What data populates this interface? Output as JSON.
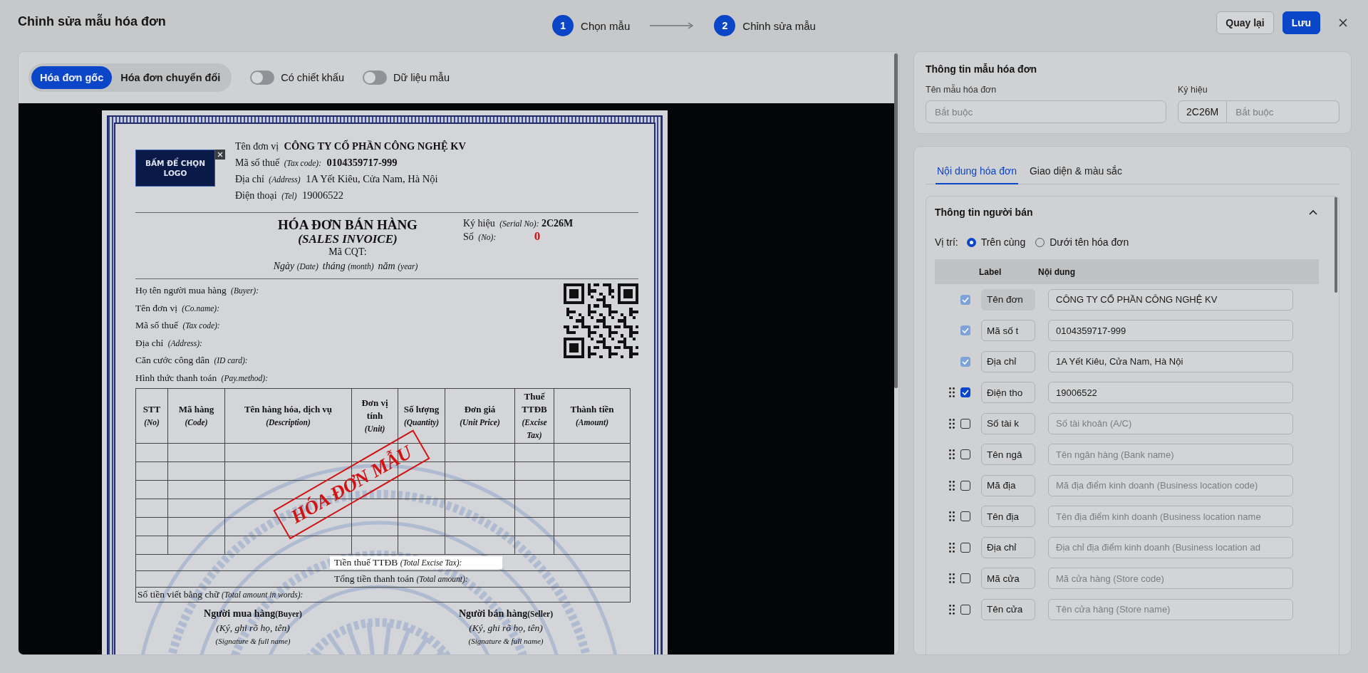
{
  "header": {
    "title": "Chỉnh sửa mẫu hóa đơn",
    "steps": [
      {
        "number": "1",
        "label": "Chọn mẫu"
      },
      {
        "number": "2",
        "label": "Chỉnh sửa mẫu"
      }
    ],
    "buttons": [
      {
        "label": "Quay lại",
        "kind": "secondary"
      },
      {
        "label": "Lưu",
        "kind": "primary"
      }
    ]
  },
  "toolbar": {
    "segments": [
      {
        "label": "Hóa đơn gốc",
        "selected": true
      },
      {
        "label": "Hóa đơn chuyển đổi",
        "selected": false
      }
    ],
    "toggles": [
      {
        "label": "Có chiết khấu",
        "on": false
      },
      {
        "label": "Dữ liệu mẫu",
        "on": false
      }
    ]
  },
  "invoice": {
    "logo_button": "BẤM ĐỂ CHỌN LOGO",
    "seller": [
      {
        "label": "Tên đơn vị",
        "value": "CÔNG TY CỔ PHẦN CÔNG NGHỆ KV",
        "bold": true
      },
      {
        "label": "Mã số thuế",
        "label_en": "(Tax code):",
        "value": "0104359717-999",
        "bold": true
      },
      {
        "label": "Địa chỉ",
        "label_en": "(Address)",
        "value": "1A Yết Kiêu, Cửa Nam, Hà Nội",
        "bold": false
      },
      {
        "label": "Điện thoại",
        "label_en": "(Tel)",
        "value": "19006522",
        "bold": false
      }
    ],
    "title": "HÓA ĐƠN BÁN HÀNG",
    "subtitle": "(SALES INVOICE)",
    "cqt": "Mã CQT:",
    "date_parts": [
      {
        "label": "Ngày",
        "en": "(Date)"
      },
      {
        "label": "tháng",
        "en": "(month)"
      },
      {
        "label": "năm",
        "en": "(year)"
      }
    ],
    "serial": {
      "label": "Ký hiệu",
      "label_en": "(Serial No):",
      "value": "2C26M"
    },
    "number": {
      "label": "Số",
      "label_en": "(No):",
      "value": "0"
    },
    "buyer": [
      {
        "label": "Họ tên người mua hàng",
        "label_en": "(Buyer):"
      },
      {
        "label": "Tên đơn vị",
        "label_en": "(Co.name):"
      },
      {
        "label": "Mã số thuế",
        "label_en": "(Tax code):"
      },
      {
        "label": "Địa chỉ",
        "label_en": "(Address):"
      },
      {
        "label": "Căn cước công dân",
        "label_en": "(ID card):"
      },
      {
        "label": "Hình thức thanh toán",
        "label_en": "(Pay.method):"
      }
    ],
    "columns": [
      {
        "label": "STT",
        "label_en": "(No)"
      },
      {
        "label": "Mã hàng",
        "label_en": "(Code)"
      },
      {
        "label": "Tên hàng hóa, dịch vụ",
        "label_en": "(Description)"
      },
      {
        "label": "Đơn vị tính",
        "label_en": "(Unit)"
      },
      {
        "label": "Số lượng",
        "label_en": "(Quantity)"
      },
      {
        "label": "Đơn giá",
        "label_en": "(Unit Price)"
      },
      {
        "label": "Thuế TTĐB",
        "label_en": "(Excise Tax)"
      },
      {
        "label": "Thành tiền",
        "label_en": "(Amount)"
      }
    ],
    "totals": [
      {
        "label": "Tiền thuế TTĐB",
        "label_en": "(Total Excise Tax):",
        "highlighted": true
      },
      {
        "label": "Tổng tiền thanh toán",
        "label_en": "(Total amount):",
        "highlighted": false
      }
    ],
    "in_words": {
      "label": "Số tiền viết bằng chữ",
      "label_en": "(Total amount in words):"
    },
    "signatures": [
      {
        "title": "Người mua hàng",
        "title_en": "(Buyer)",
        "note": "(Ký, ghi rõ họ, tên)",
        "note_en": "(Signature & full name)"
      },
      {
        "title": "Người bán hàng",
        "title_en": "(Seller)",
        "note": "(Ký, ghi rõ họ, tên)",
        "note_en": "(Signature & full name)"
      }
    ],
    "stamp": "HÓA ĐƠN MẪU"
  },
  "template_info": {
    "title": "Thông tin mẫu hóa đơn",
    "name_field": {
      "label": "Tên mẫu hóa đơn",
      "placeholder": "Bắt buộc"
    },
    "symbol_field": {
      "label": "Ký hiệu",
      "prefix": "2C26M",
      "placeholder": "Bắt buộc"
    }
  },
  "content_tabs": [
    {
      "label": "Nội dung hóa đơn",
      "selected": true
    },
    {
      "label": "Giao diện & màu sắc",
      "selected": false
    }
  ],
  "seller_section": {
    "title": "Thông tin người bán",
    "expanded": true,
    "position_label": "Vị trí:",
    "positions": [
      {
        "label": "Trên cùng",
        "selected": true
      },
      {
        "label": "Dưới tên hóa đơn",
        "selected": false
      }
    ],
    "columns": [
      "Label",
      "Nội dung"
    ],
    "rows": [
      {
        "label": "Tên đơn",
        "checked": true,
        "disabled": true,
        "value": "CÔNG TY CỔ PHẦN CÔNG NGHỆ KV"
      },
      {
        "label": "Mã số t",
        "checked": true,
        "disabled": true,
        "value": "0104359717-999"
      },
      {
        "label": "Địa chỉ",
        "checked": true,
        "disabled": true,
        "value": "1A Yết Kiêu, Cửa Nam, Hà Nội"
      },
      {
        "label": "Điện tho",
        "checked": true,
        "disabled": false,
        "value": "19006522"
      },
      {
        "label": "Số tài k",
        "checked": false,
        "disabled": false,
        "placeholder": "Số tài khoản (A/C)"
      },
      {
        "label": "Tên ngâ",
        "checked": false,
        "disabled": false,
        "placeholder": "Tên ngân hàng (Bank name)"
      },
      {
        "label": "Mã địa",
        "checked": false,
        "disabled": false,
        "placeholder": "Mã địa điểm kinh doanh (Business location code)"
      },
      {
        "label": "Tên địa",
        "checked": false,
        "disabled": false,
        "placeholder": "Tên địa điểm kinh doanh (Business location name"
      },
      {
        "label": "Địa chỉ",
        "checked": false,
        "disabled": false,
        "placeholder": "Địa chỉ địa điểm kinh doanh (Business location ad"
      },
      {
        "label": "Mã cửa",
        "checked": false,
        "disabled": false,
        "placeholder": "Mã cửa hàng (Store code)"
      },
      {
        "label": "Tên cửa",
        "checked": false,
        "disabled": false,
        "placeholder": "Tên cửa hàng (Store name)"
      }
    ]
  }
}
